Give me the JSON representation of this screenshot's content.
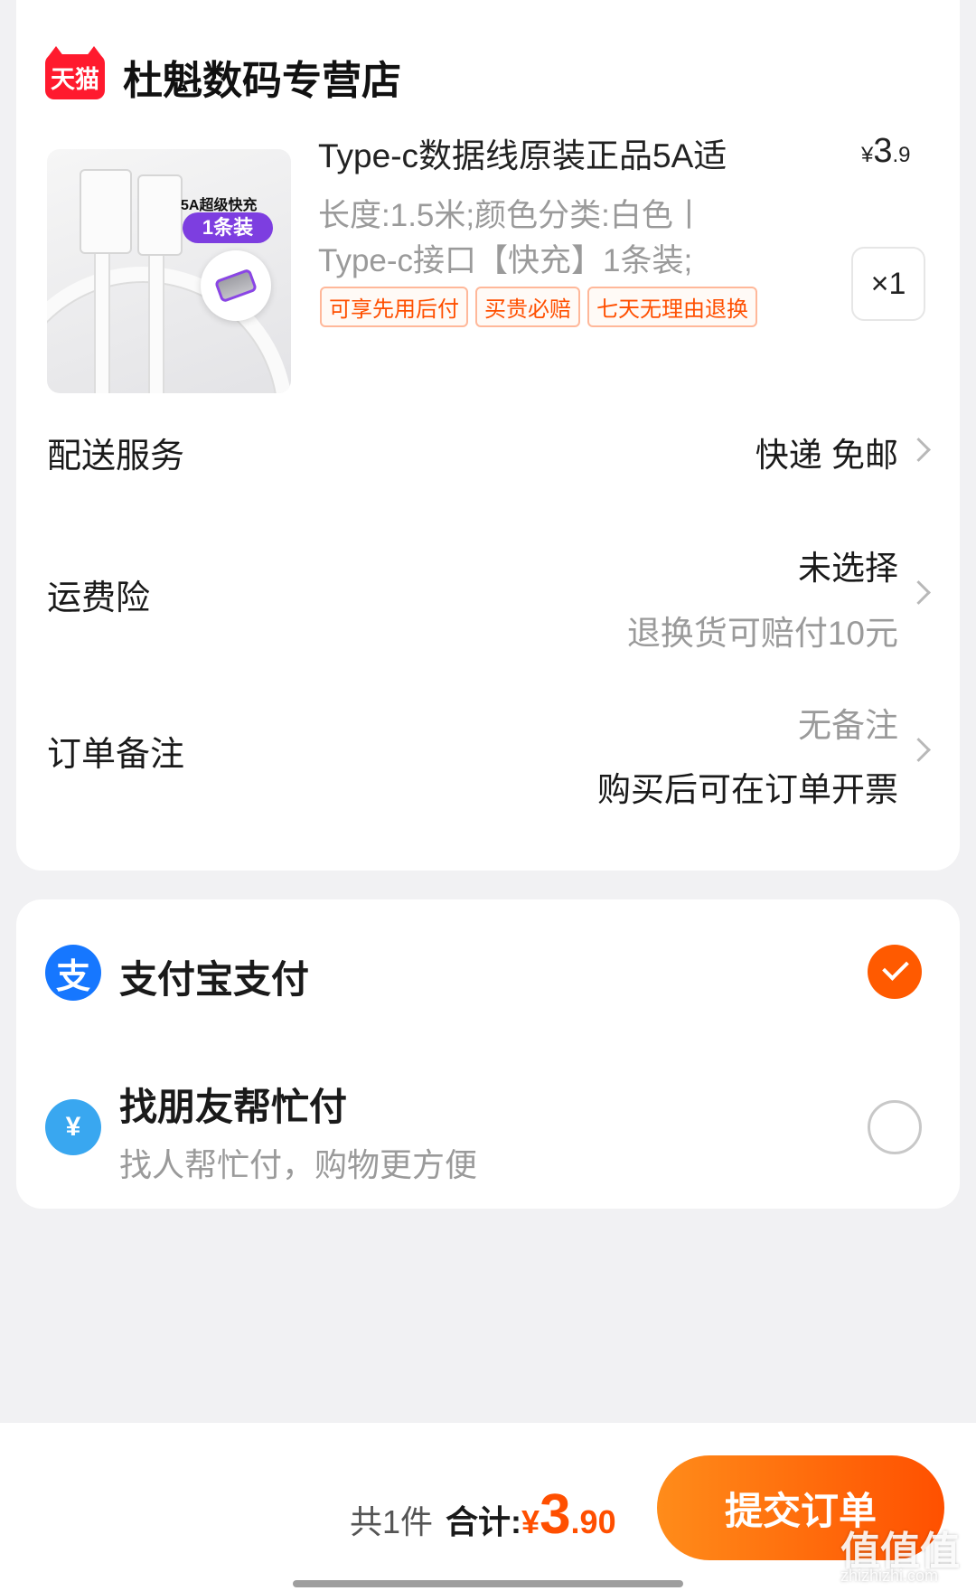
{
  "shop": {
    "logo_text": "天猫",
    "name": "杜魁数码专营店"
  },
  "product": {
    "title": "Type-c数据线原装正品5A适",
    "price": {
      "currency": "¥",
      "integer": "3",
      "decimal": ".9"
    },
    "spec_line1": "长度:1.5米;颜色分类:白色丨",
    "spec_line2": "Type-c接口【快充】1条装;",
    "tags": [
      "可享先用后付",
      "买贵必赔",
      "七天无理由退换"
    ],
    "quantity": "×1",
    "image_text": {
      "tag": "5A超级快充",
      "pill": "1条装"
    }
  },
  "rows": {
    "delivery": {
      "label": "配送服务",
      "value": "快递 免邮"
    },
    "insurance": {
      "label": "运费险",
      "value": "未选择",
      "sub": "退换货可赔付10元"
    },
    "note": {
      "label": "订单备注",
      "value": "无备注",
      "sub": "购买后可在订单开票"
    }
  },
  "payment": {
    "alipay": {
      "label": "支付宝支付",
      "icon_glyph": "支",
      "selected": true
    },
    "friend": {
      "label": "找朋友帮忙付",
      "sub": "找人帮忙付，购物更方便",
      "icon_glyph": "¥",
      "selected": false
    }
  },
  "footer": {
    "count": "共1件",
    "total_label": "合计:",
    "total": {
      "currency": "¥",
      "integer": "3",
      "decimal": ".90"
    },
    "submit_label": "提交订单"
  },
  "watermark": {
    "text": "值值值",
    "sub": "zhizhizhi.com"
  },
  "colors": {
    "accent": "#ff5000",
    "alipay": "#1677ff",
    "tmall": "#ff1a2e"
  }
}
